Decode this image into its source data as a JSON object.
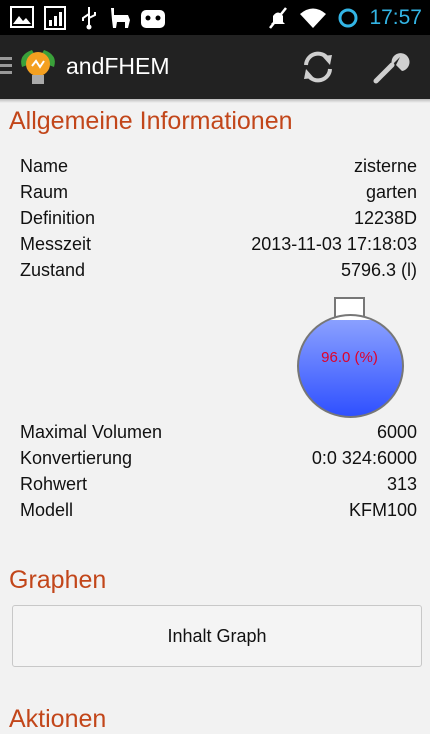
{
  "status_bar": {
    "time": "17:57",
    "icons": [
      "image-icon",
      "signal-bars-icon",
      "usb-icon",
      "llama-icon",
      "android-icon",
      "mute-icon",
      "wifi-icon",
      "sync-ring-icon"
    ]
  },
  "action_bar": {
    "title": "andFHEM",
    "icons": [
      "menu-icon",
      "bulb-logo-icon",
      "refresh-icon",
      "wrench-icon"
    ]
  },
  "general_info": {
    "title": "Allgemeine Informationen",
    "rows": [
      {
        "key": "Name",
        "value": "zisterne"
      },
      {
        "key": "Raum",
        "value": "garten"
      },
      {
        "key": "Definition",
        "value": "12238D"
      },
      {
        "key": "Messzeit",
        "value": "2013-11-03 17:18:03"
      },
      {
        "key": "Zustand",
        "value": "5796.3 (l)"
      }
    ],
    "tank": {
      "label": "96.0 (%)",
      "fill_fraction": 0.96,
      "colors": {
        "fill_top": "#8aa0ff",
        "fill_bottom": "#2f50ff",
        "label": "#e0002a"
      }
    },
    "rows2": [
      {
        "key": "Maximal Volumen",
        "value": "6000"
      },
      {
        "key": "Konvertierung",
        "value": "0:0 324:6000"
      },
      {
        "key": "Rohwert",
        "value": "313"
      },
      {
        "key": "Modell",
        "value": "KFM100"
      }
    ]
  },
  "graphs": {
    "title": "Graphen",
    "button_label": "Inhalt Graph"
  },
  "actions": {
    "title": "Aktionen"
  },
  "colors": {
    "accent": "#c2461a",
    "status_time": "#33b5e5",
    "action_bar": "#222222"
  }
}
